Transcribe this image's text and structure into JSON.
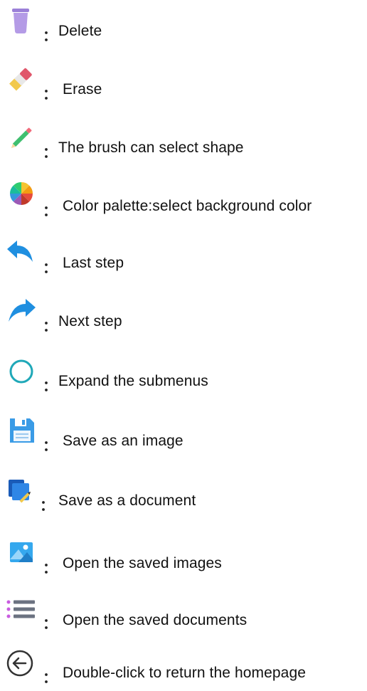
{
  "legend": {
    "separator": "：",
    "items": [
      {
        "icon": "trash-icon",
        "label": "Delete"
      },
      {
        "icon": "eraser-icon",
        "label": "Erase"
      },
      {
        "icon": "pencil-icon",
        "label": "The brush can select shape"
      },
      {
        "icon": "color-palette-icon",
        "label": "Color palette:select background color"
      },
      {
        "icon": "undo-arrow-icon",
        "label": "Last step"
      },
      {
        "icon": "redo-arrow-icon",
        "label": "Next step"
      },
      {
        "icon": "circle-icon",
        "label": "Expand the submenus"
      },
      {
        "icon": "floppy-disk-icon",
        "label": "Save as an image"
      },
      {
        "icon": "document-edit-icon",
        "label": "Save as a document"
      },
      {
        "icon": "image-gallery-icon",
        "label": "Open the saved images"
      },
      {
        "icon": "list-icon",
        "label": "Open the saved documents"
      },
      {
        "icon": "back-circle-icon",
        "label": "Double-click to return the homepage"
      }
    ]
  },
  "colors": {
    "trash": "#b49be6",
    "eraser_body": "#e8e8e8",
    "eraser_tip": "#e0566b",
    "eraser_band": "#f2c94c",
    "pencil": "#3fbf6f",
    "pencil_tip": "#f06a7a",
    "arrow": "#1f8fe0",
    "circle": "#1fa8b8",
    "floppy": "#3a9be6",
    "document": "#2a73d6",
    "image": "#35a8ee",
    "list_bullets": "#c95ce0",
    "list_lines": "#6b7280",
    "back_circle": "#333333"
  }
}
